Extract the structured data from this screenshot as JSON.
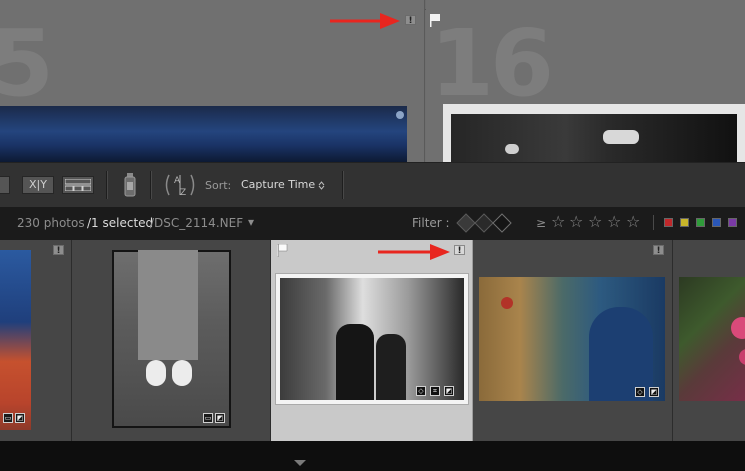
{
  "grid": {
    "left_cell_number": "5",
    "right_cell_number": "16",
    "badge_symbol": "!"
  },
  "toolbar": {
    "sort_label": "Sort:",
    "sort_value": "Capture Time",
    "sort_chevron": "⌃⌄",
    "compare_label": "X|Y",
    "sort_az_icon": "A↓Z"
  },
  "infobar": {
    "photo_count": "230 photos",
    "selected": "/1 selected",
    "filename": "/DSC_2114.NEF",
    "dropdown": "▾",
    "filter_label": "Filter :",
    "rating_op": "≥",
    "stars": [
      "☆",
      "☆",
      "☆",
      "☆",
      "☆"
    ]
  },
  "colors": {
    "arrow": "#e8261f",
    "label_red": "#c0282b",
    "label_yellow": "#c9b62a",
    "label_green": "#2f9b3a",
    "label_blue": "#2a57b8",
    "label_purple": "#7b3aa6"
  },
  "filmstrip": {
    "badge_symbol": "!"
  }
}
